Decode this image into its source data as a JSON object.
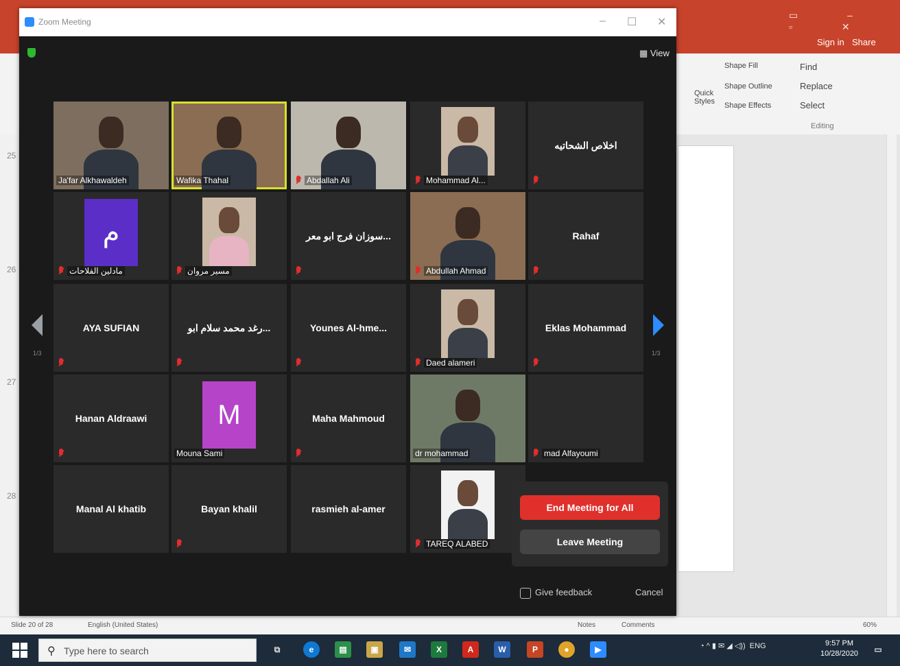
{
  "powerpoint": {
    "sign_in": "Sign in",
    "share": "Share",
    "ribbon": {
      "shape_fill": "Shape Fill",
      "shape_outline": "Shape Outline",
      "shape_effects": "Shape Effects",
      "quick_styles": "Quick Styles",
      "find": "Find",
      "replace": "Replace",
      "select": "Select",
      "editing": "Editing"
    },
    "slide_numbers": [
      "25",
      "26",
      "27",
      "28"
    ],
    "status": {
      "slide": "Slide 20 of 28",
      "language": "English (United States)",
      "notes": "Notes",
      "comments": "Comments",
      "zoom": "60%"
    }
  },
  "taskbar": {
    "search_placeholder": "Type here to search",
    "tray_lang": "ENG",
    "time": "9:57 PM",
    "date": "10/28/2020"
  },
  "zoom": {
    "window_title": "Zoom Meeting",
    "view_label": "View",
    "page_indicator": "1/3",
    "participants": [
      {
        "name": "Ja'far Alkhawaldeh",
        "type": "video",
        "muted": false
      },
      {
        "name": "Wafika Thahal",
        "type": "video",
        "muted": false,
        "talking": true
      },
      {
        "name": "Abdallah Ali",
        "type": "video",
        "muted": true
      },
      {
        "name": "Mohammad Al...",
        "type": "photo",
        "muted": true
      },
      {
        "name": "اخلاص الشحاتيه",
        "type": "name",
        "muted": true
      },
      {
        "name": "مادلين الفلاحات",
        "type": "avatar",
        "avatar_letter": "م",
        "avatar_color": "#5b2fc7",
        "muted": true
      },
      {
        "name": "مسير مروان",
        "type": "photo",
        "muted": true
      },
      {
        "name": "سوزان فرج ابو معر...",
        "type": "name",
        "muted": true
      },
      {
        "name": "Abdullah Ahmad",
        "type": "video",
        "muted": true
      },
      {
        "name": "Rahaf",
        "type": "name",
        "muted": true
      },
      {
        "name": "AYA SUFIAN",
        "type": "name",
        "muted": true
      },
      {
        "name": "رغد محمد سلام ابو...",
        "type": "name",
        "muted": true
      },
      {
        "name": "Younes Al-hme...",
        "type": "name",
        "muted": true
      },
      {
        "name": "Daed alameri",
        "type": "photo",
        "muted": true
      },
      {
        "name": "Eklas Mohammad",
        "type": "name",
        "muted": true
      },
      {
        "name": "Hanan Aldraawi",
        "type": "name",
        "muted": true
      },
      {
        "name": "Mouna Sami",
        "type": "avatar",
        "avatar_letter": "M",
        "avatar_color": "#b544c9",
        "muted": false
      },
      {
        "name": "Maha Mahmoud",
        "type": "name",
        "muted": true
      },
      {
        "name": "dr mohammad",
        "type": "video",
        "muted": false
      },
      {
        "name": "mad Alfayoumi",
        "type": "blank",
        "muted": true
      },
      {
        "name": "Manal Al khatib",
        "type": "name",
        "muted": false
      },
      {
        "name": "Bayan khalil",
        "type": "name",
        "muted": true
      },
      {
        "name": "rasmieh al-amer",
        "type": "name",
        "muted": false
      },
      {
        "name": "TAREQ ALABED",
        "type": "photo",
        "muted": true
      }
    ],
    "end_popover": {
      "end_all": "End Meeting for All",
      "leave": "Leave Meeting"
    },
    "give_feedback": "Give feedback",
    "cancel": "Cancel"
  }
}
